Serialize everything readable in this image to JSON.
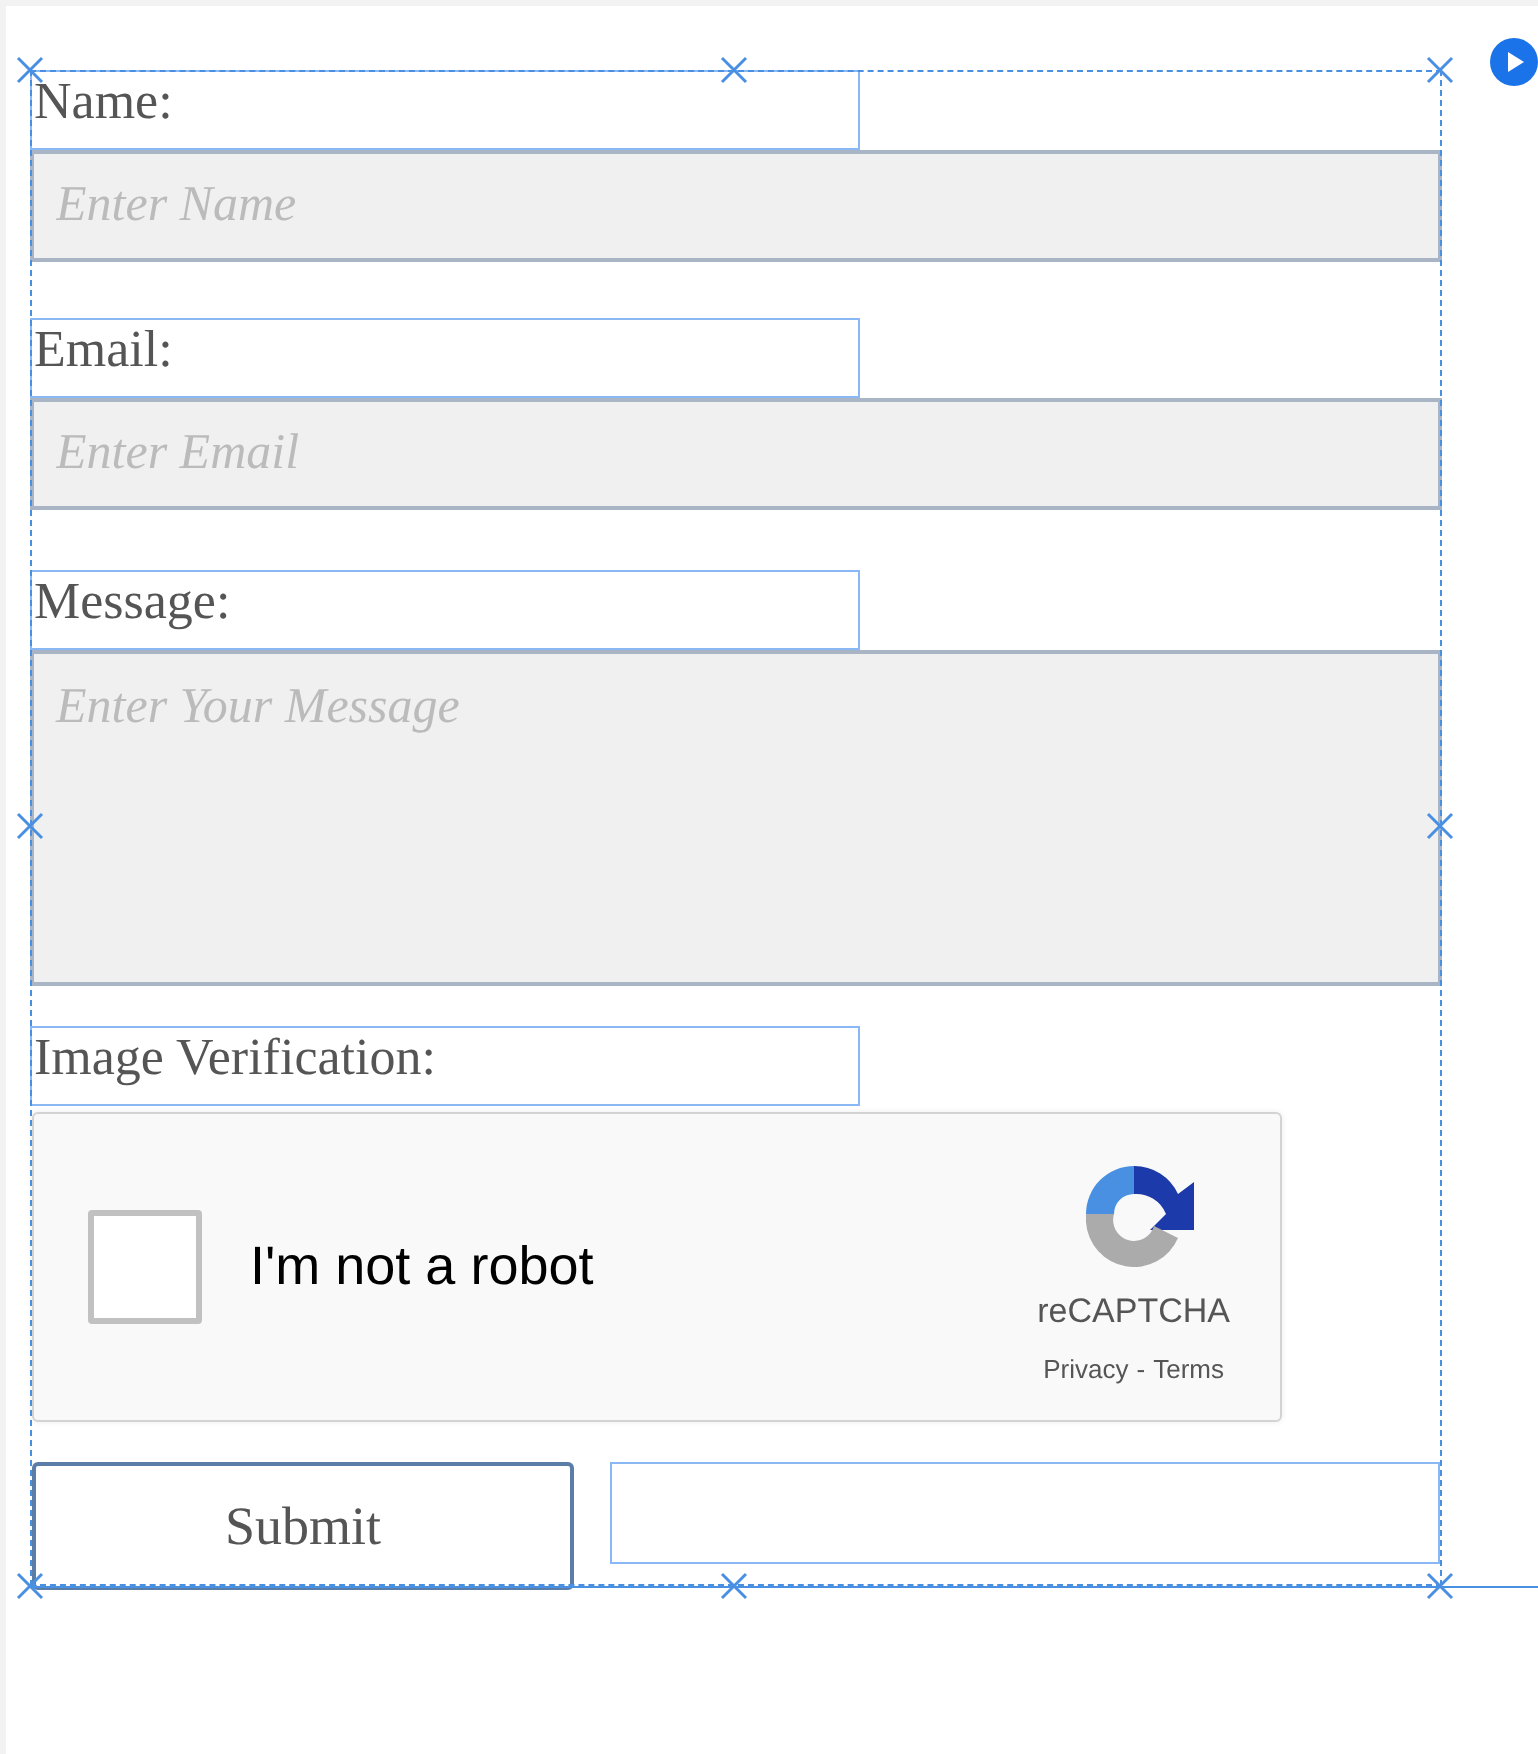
{
  "fields": [
    {
      "kind": "input",
      "label": "Name:",
      "placeholder": "Enter Name"
    },
    {
      "kind": "input",
      "label": "Email:",
      "placeholder": "Enter Email"
    },
    {
      "kind": "textarea",
      "label": "Message:",
      "placeholder": "Enter Your Message"
    },
    {
      "kind": "captcha",
      "label": "Image Verification:",
      "checkbox_label": "I'm not a robot",
      "checked": false,
      "brand": "reCAPTCHA",
      "privacy_link": "Privacy",
      "separator": "-",
      "terms_link": "Terms"
    }
  ],
  "submit": {
    "label": "Submit"
  }
}
